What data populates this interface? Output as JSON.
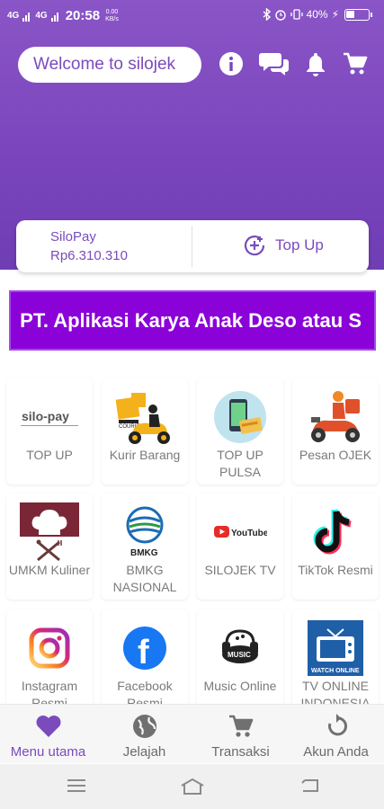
{
  "status_bar": {
    "signal1": "4G",
    "signal2": "4G",
    "time": "20:58",
    "speed_value": "0.00",
    "speed_unit": "KB/s",
    "battery": "40%",
    "battery_level": 0.4
  },
  "header": {
    "welcome_text": "Welcome to silojek",
    "icons": [
      "info-icon",
      "chat-icon",
      "bell-icon",
      "cart-icon"
    ],
    "color": "#7b46bd"
  },
  "balance": {
    "name": "SiloPay",
    "amount": "Rp6.310.310",
    "topup_label": "Top Up"
  },
  "banner": {
    "text": "PT. Aplikasi Karya Anak Deso atau S",
    "color": "#8b02d8"
  },
  "menu": [
    {
      "label": "TOP UP",
      "icon": "silopay-logo",
      "logo_text": "silo-pay"
    },
    {
      "label": "Kurir Barang",
      "icon": "courier-scooter-icon",
      "logo_text": "COURIER"
    },
    {
      "label": "TOP UP PULSA",
      "icon": "phone-card-icon"
    },
    {
      "label": "Pesan OJEK",
      "icon": "ojek-scooter-icon"
    },
    {
      "label": "UMKM Kuliner",
      "icon": "chef-hat-icon"
    },
    {
      "label": "BMKG NASIONAL",
      "icon": "bmkg-logo",
      "logo_text": "BMKG"
    },
    {
      "label": "SILOJEK TV",
      "icon": "youtube-logo",
      "logo_text": "YouTube"
    },
    {
      "label": "TikTok Resmi",
      "icon": "tiktok-logo"
    },
    {
      "label": "Instagram Resmi",
      "icon": "instagram-logo"
    },
    {
      "label": "Facebook Resmi",
      "icon": "facebook-logo",
      "logo_text": "f"
    },
    {
      "label": "Music Online",
      "icon": "music-logo",
      "logo_text": "MUSIC"
    },
    {
      "label": "TV ONLINE INDONESIA",
      "icon": "tv-online-logo",
      "logo_text": "WATCH ONLINE"
    }
  ],
  "bottom_nav": [
    {
      "label": "Menu utama",
      "icon": "heart-icon",
      "active": true
    },
    {
      "label": "Jelajah",
      "icon": "globe-icon",
      "active": false
    },
    {
      "label": "Transaksi",
      "icon": "cart-icon",
      "active": false
    },
    {
      "label": "Akun Anda",
      "icon": "refresh-icon",
      "active": false
    }
  ],
  "accent_color": "#7a4bbc"
}
